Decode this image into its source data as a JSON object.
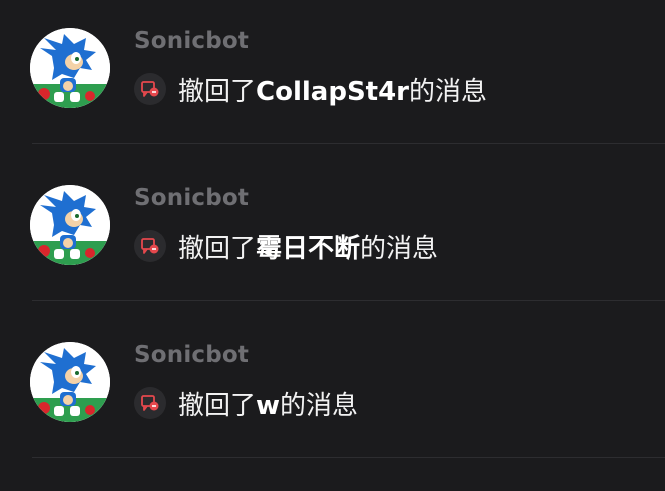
{
  "messages": [
    {
      "sender": "Sonicbot",
      "prefix": "撤回了",
      "target": "CollapSt4r",
      "suffix": "的消息",
      "icon": "recall-icon"
    },
    {
      "sender": "Sonicbot",
      "prefix": "撤回了",
      "target": "霉日不断",
      "suffix": "的消息",
      "icon": "recall-icon"
    },
    {
      "sender": "Sonicbot",
      "prefix": "撤回了",
      "target": "w",
      "suffix": "的消息",
      "icon": "recall-icon"
    }
  ],
  "colors": {
    "background": "#1b1b1d",
    "sender_name": "#6f6f73",
    "message_text": "#f2f2f2",
    "recall_accent": "#e5484d",
    "divider": "#2d2d30"
  }
}
